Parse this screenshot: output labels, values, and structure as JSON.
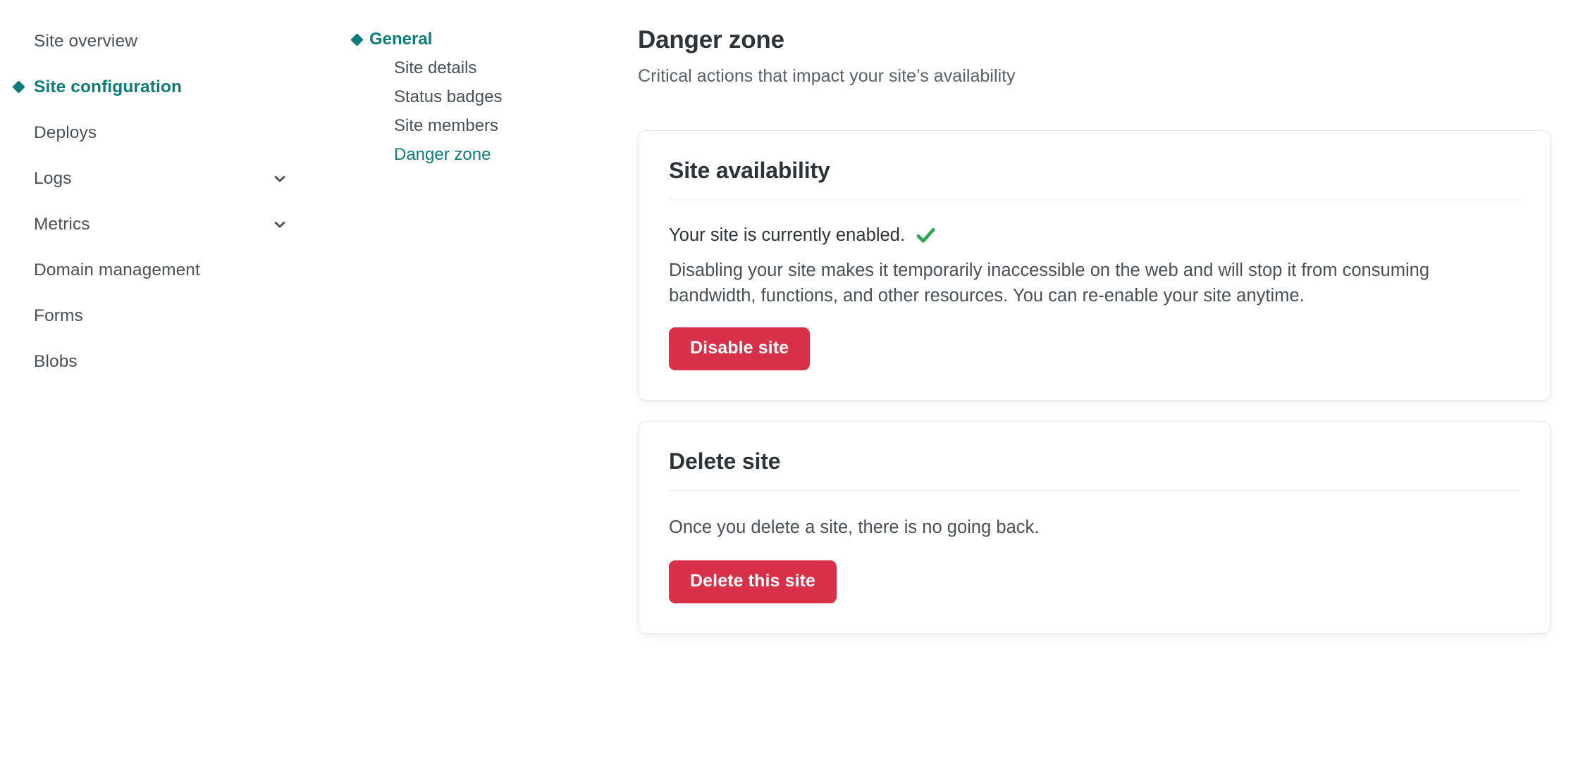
{
  "theme": {
    "accent_teal": "#0E7C7B",
    "danger_red": "#D9304A",
    "success_green": "#2FA44F",
    "text_primary": "#2E3338",
    "text_secondary": "#4A5057",
    "card_border": "#E6E8EB"
  },
  "primary_nav": {
    "items": [
      {
        "label": "Site overview",
        "active": false,
        "has_chevron": false
      },
      {
        "label": "Site configuration",
        "active": true,
        "has_chevron": false
      },
      {
        "label": "Deploys",
        "active": false,
        "has_chevron": false
      },
      {
        "label": "Logs",
        "active": false,
        "has_chevron": true
      },
      {
        "label": "Metrics",
        "active": false,
        "has_chevron": true
      },
      {
        "label": "Domain management",
        "active": false,
        "has_chevron": false
      },
      {
        "label": "Forms",
        "active": false,
        "has_chevron": false
      },
      {
        "label": "Blobs",
        "active": false,
        "has_chevron": false
      }
    ]
  },
  "secondary_nav": {
    "group_label": "General",
    "items": [
      {
        "label": "Site details",
        "active": false
      },
      {
        "label": "Status badges",
        "active": false
      },
      {
        "label": "Site members",
        "active": false
      },
      {
        "label": "Danger zone",
        "active": true
      }
    ]
  },
  "main": {
    "title": "Danger zone",
    "subtitle": "Critical actions that impact your site’s availability",
    "cards": [
      {
        "heading": "Site availability",
        "status_text": "Your site is currently enabled.",
        "status_icon": "green-check-icon",
        "body": "Disabling your site makes it temporarily inaccessible on the web and will stop it from consuming bandwidth, functions, and other resources. You can re-enable your site anytime.",
        "button_label": "Disable site"
      },
      {
        "heading": "Delete site",
        "body": "Once you delete a site, there is no going back.",
        "button_label": "Delete this site"
      }
    ]
  }
}
